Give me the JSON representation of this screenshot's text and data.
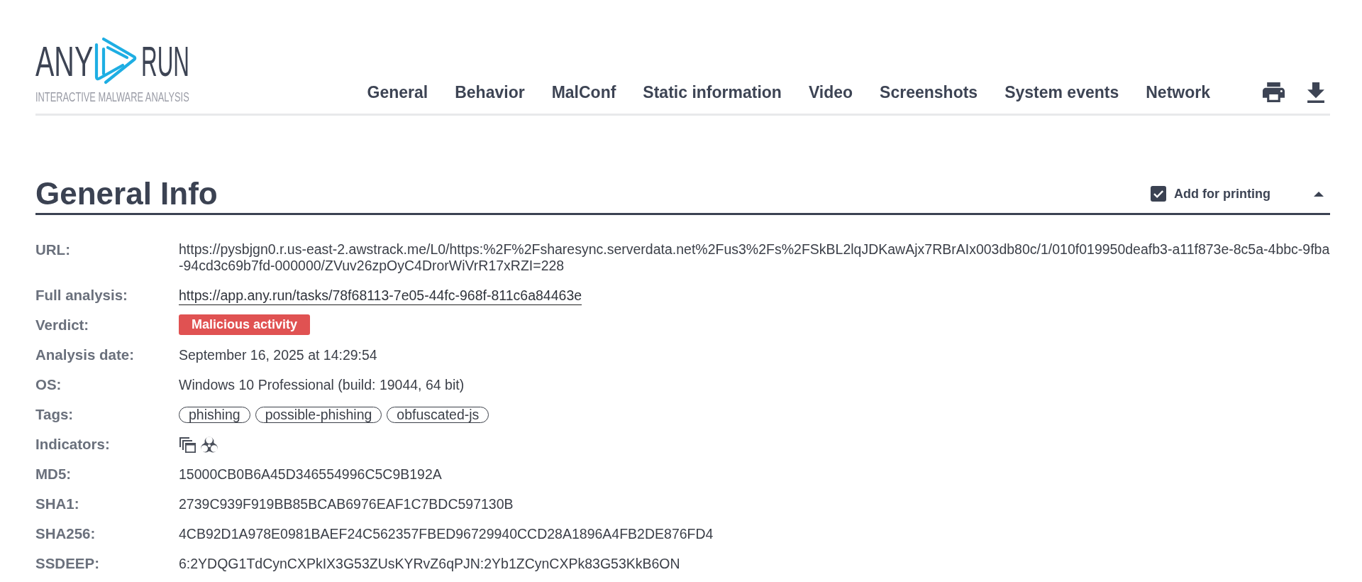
{
  "header": {
    "logo": {
      "left_text": "ANY",
      "right_text": "RUN",
      "tagline": "INTERACTIVE MALWARE ANALYSIS"
    },
    "nav": [
      "General",
      "Behavior",
      "MalConf",
      "Static information",
      "Video",
      "Screenshots",
      "System events",
      "Network"
    ]
  },
  "section": {
    "title": "General Info",
    "print_toggle": {
      "label": "Add for printing",
      "checked": true
    },
    "expanded": true,
    "fields": [
      {
        "kind": "text",
        "label": "URL:",
        "value": "https://pysbjgn0.r.us-east-2.awstrack.me/L0/https:%2F%2Fsharesync.serverdata.net%2Fus3%2Fs%2FSkBL2lqJDKawAjx7RBrAIx003db80c/1/010f019950deafb3-a11f873e-8c5a-4bbc-9fba-94cd3c69b7fd-000000/ZVuv26zpOyC4DrorWiVrR17xRZI=228"
      },
      {
        "kind": "link",
        "label": "Full analysis:",
        "value": "https://app.any.run/tasks/78f68113-7e05-44fc-968f-811c6a84463e"
      },
      {
        "kind": "badge",
        "label": "Verdict:",
        "value": "Malicious activity"
      },
      {
        "kind": "text",
        "label": "Analysis date:",
        "value": "September 16, 2025 at 14:29:54"
      },
      {
        "kind": "text",
        "label": "OS:",
        "value": "Windows 10 Professional (build: 19044, 64 bit)"
      },
      {
        "kind": "tags",
        "label": "Tags:",
        "tags": [
          "phishing",
          "possible-phishing",
          "obfuscated-js"
        ]
      },
      {
        "kind": "icons",
        "label": "Indicators:",
        "icons": [
          {
            "kind": "windows"
          },
          {
            "kind": "biohazard"
          }
        ]
      },
      {
        "kind": "text",
        "label": "MD5:",
        "value": "15000CB0B6A45D346554996C5C9B192A"
      },
      {
        "kind": "text",
        "label": "SHA1:",
        "value": "2739C939F919BB85BCAB6976EAF1C7BDC597130B"
      },
      {
        "kind": "text",
        "label": "SHA256:",
        "value": "4CB92D1A978E0981BAEF24C562357FBED96729940CCD28A1896A4FB2DE876FD4"
      },
      {
        "kind": "text",
        "label": "SSDEEP:",
        "value": "6:2YDQG1TdCynCXPkIX3G53ZUsKYRvZ6qPJN:2Yb1ZCynCXPk83G53KkB6ON"
      }
    ]
  }
}
